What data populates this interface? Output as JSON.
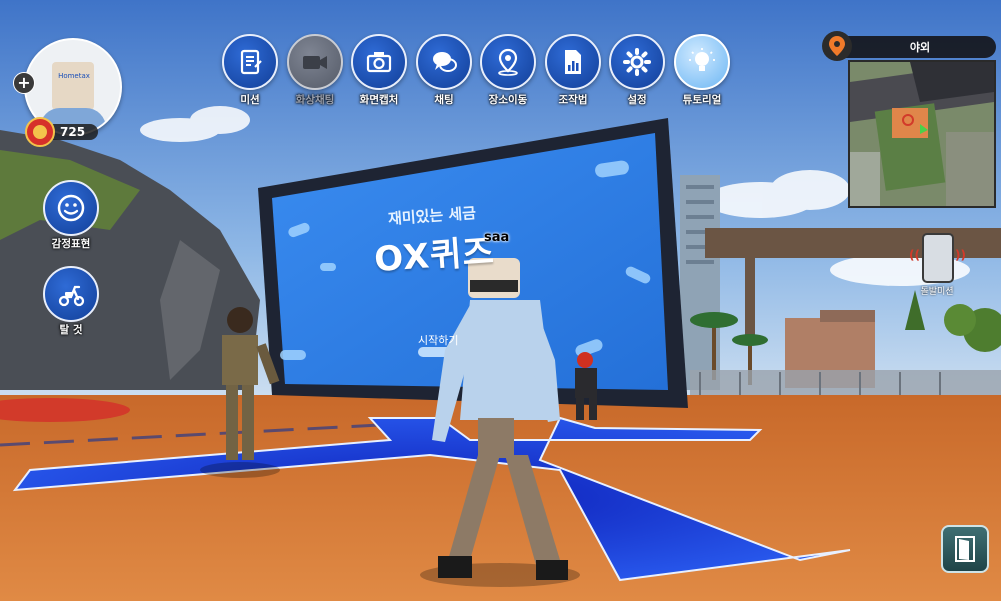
{
  "player": {
    "coins": "725",
    "avatar_cap_text": "Hometax",
    "add_label": "+"
  },
  "toolbar": [
    {
      "label": "미션",
      "icon": "clipboard-icon",
      "state": "normal"
    },
    {
      "label": "화상채팅",
      "icon": "video-camera-icon",
      "state": "disabled"
    },
    {
      "label": "화면캡처",
      "icon": "camera-icon",
      "state": "normal"
    },
    {
      "label": "채팅",
      "icon": "chat-bubbles-icon",
      "state": "normal"
    },
    {
      "label": "장소이동",
      "icon": "map-pin-icon",
      "state": "normal"
    },
    {
      "label": "조작법",
      "icon": "document-chart-icon",
      "state": "normal"
    },
    {
      "label": "설정",
      "icon": "gear-icon",
      "state": "normal"
    },
    {
      "label": "튜토리얼",
      "icon": "lightbulb-icon",
      "state": "active"
    }
  ],
  "side": {
    "emotion_label": "감정표현",
    "ride_label": "탈 것"
  },
  "minimap": {
    "location": "야외"
  },
  "phone": {
    "label": "돌발미션"
  },
  "billboard": {
    "subtitle": "재미있는 세금",
    "title": "OX퀴즈",
    "start_label": "시작하기"
  },
  "nametag": "saa",
  "colors": {
    "accent": "#1a4fb8",
    "floor": "#d97a35",
    "floor_x": "#1f3fd6",
    "screen": "#2f7ee6"
  }
}
